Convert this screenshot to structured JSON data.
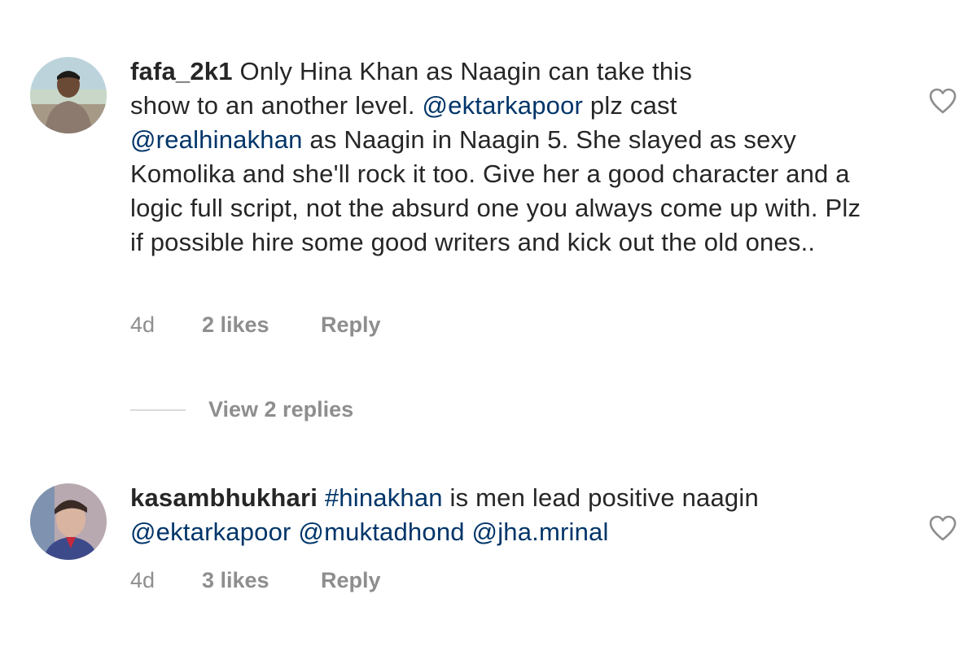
{
  "comments": [
    {
      "username": "fafa_2k1",
      "segments": [
        {
          "type": "text",
          "value": " Only Hina Khan as Naagin can take this "
        },
        {
          "type": "text",
          "value": "show to an another level. "
        },
        {
          "type": "mention",
          "value": "@ektarkapoor"
        },
        {
          "type": "text",
          "value": " plz cast "
        },
        {
          "type": "mention",
          "value": "@realhinakhan"
        },
        {
          "type": "text",
          "value": " as Naagin in Naagin 5. She slayed as sexy Komolika and she'll rock it too. Give her a good character and a logic full script, not the absurd one you always come up with. Plz if possible hire some good writers and kick out the old ones.."
        }
      ],
      "time": "4d",
      "likes": "2 likes",
      "reply_label": "Reply",
      "like_icon": "heart-outline-icon"
    },
    {
      "username": "kasambhukhari",
      "segments": [
        {
          "type": "text",
          "value": " "
        },
        {
          "type": "mention",
          "value": "#hinakhan"
        },
        {
          "type": "text",
          "value": " is men lead positive naagin "
        },
        {
          "type": "mention",
          "value": "@ektarkapoor"
        },
        {
          "type": "text",
          "value": " "
        },
        {
          "type": "mention",
          "value": "@muktadhond"
        },
        {
          "type": "text",
          "value": " "
        },
        {
          "type": "mention",
          "value": "@jha.mrinal"
        }
      ],
      "time": "4d",
      "likes": "3 likes",
      "reply_label": "Reply",
      "like_icon": "heart-outline-icon"
    }
  ],
  "view_replies": {
    "label": "View 2 replies"
  },
  "colors": {
    "text": "#262626",
    "mention": "#003569",
    "meta": "#8e8e8e",
    "divider": "#dbdbdb"
  }
}
